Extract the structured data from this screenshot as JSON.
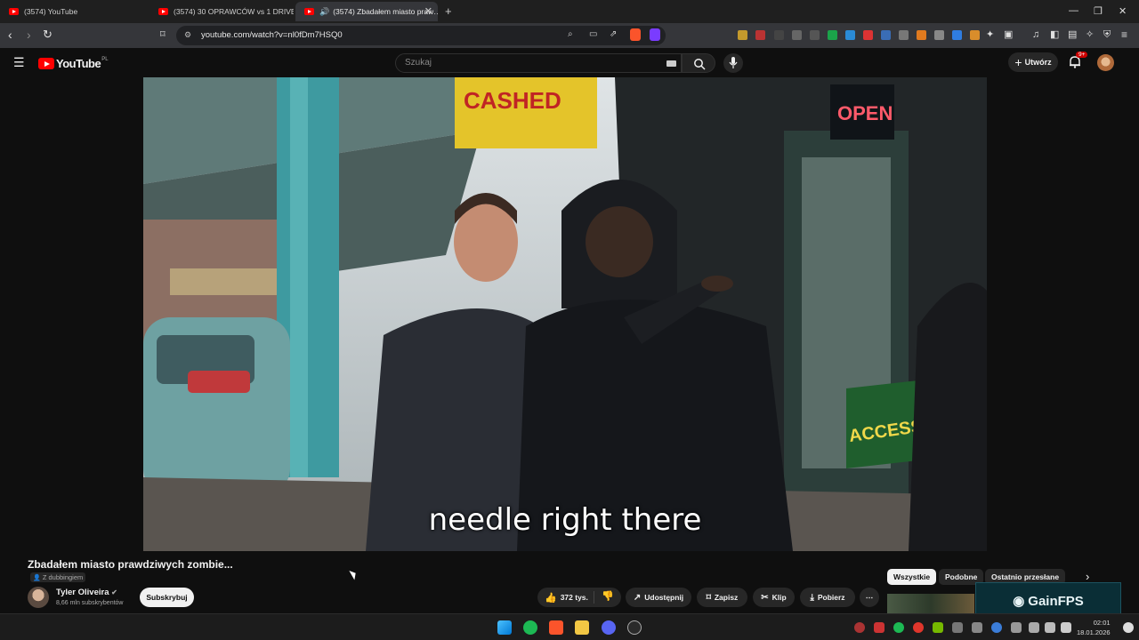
{
  "tabs": [
    {
      "title": "(3574) YouTube",
      "active": false
    },
    {
      "title": "(3574) 30 OPRAWCÓW vs 1 DRIVEM…",
      "active": false
    },
    {
      "title": "(3574) Zbadałem miasto praw…",
      "active": true
    }
  ],
  "address_bar": {
    "url": "youtube.com/watch?v=nl0fDm7HSQ0"
  },
  "youtube": {
    "logo_text": "YouTube",
    "logo_region": "PL",
    "search_placeholder": "Szukaj",
    "create_label": "Utwórz",
    "notif_badge": "9+"
  },
  "video": {
    "subtitle": "needle right there",
    "scene_signs": {
      "store": "CASHED",
      "open": "OPEN",
      "access": "ACCESS"
    },
    "title": "Zbadałem miasto prawdziwych zombie...",
    "dub_badge": "Z dubbingiem",
    "channel": "Tyler Oliveira",
    "subscribers": "8,66 mln subskrybentów",
    "subscribe_label": "Subskrybuj"
  },
  "actions": {
    "likes": "372 tys.",
    "share": "Udostępnij",
    "save": "Zapisz",
    "clip": "Klip",
    "download": "Pobierz"
  },
  "chips": [
    "Wszystkie",
    "Podobne",
    "Ostatnio przesłane"
  ],
  "overlay_brand": "GainFPS",
  "clock": {
    "time": "02:01",
    "date": "18.01.2026"
  },
  "colors": {
    "yt_red": "#ff0000",
    "bg": "#0f0f0f",
    "chip_bg": "#272727"
  }
}
